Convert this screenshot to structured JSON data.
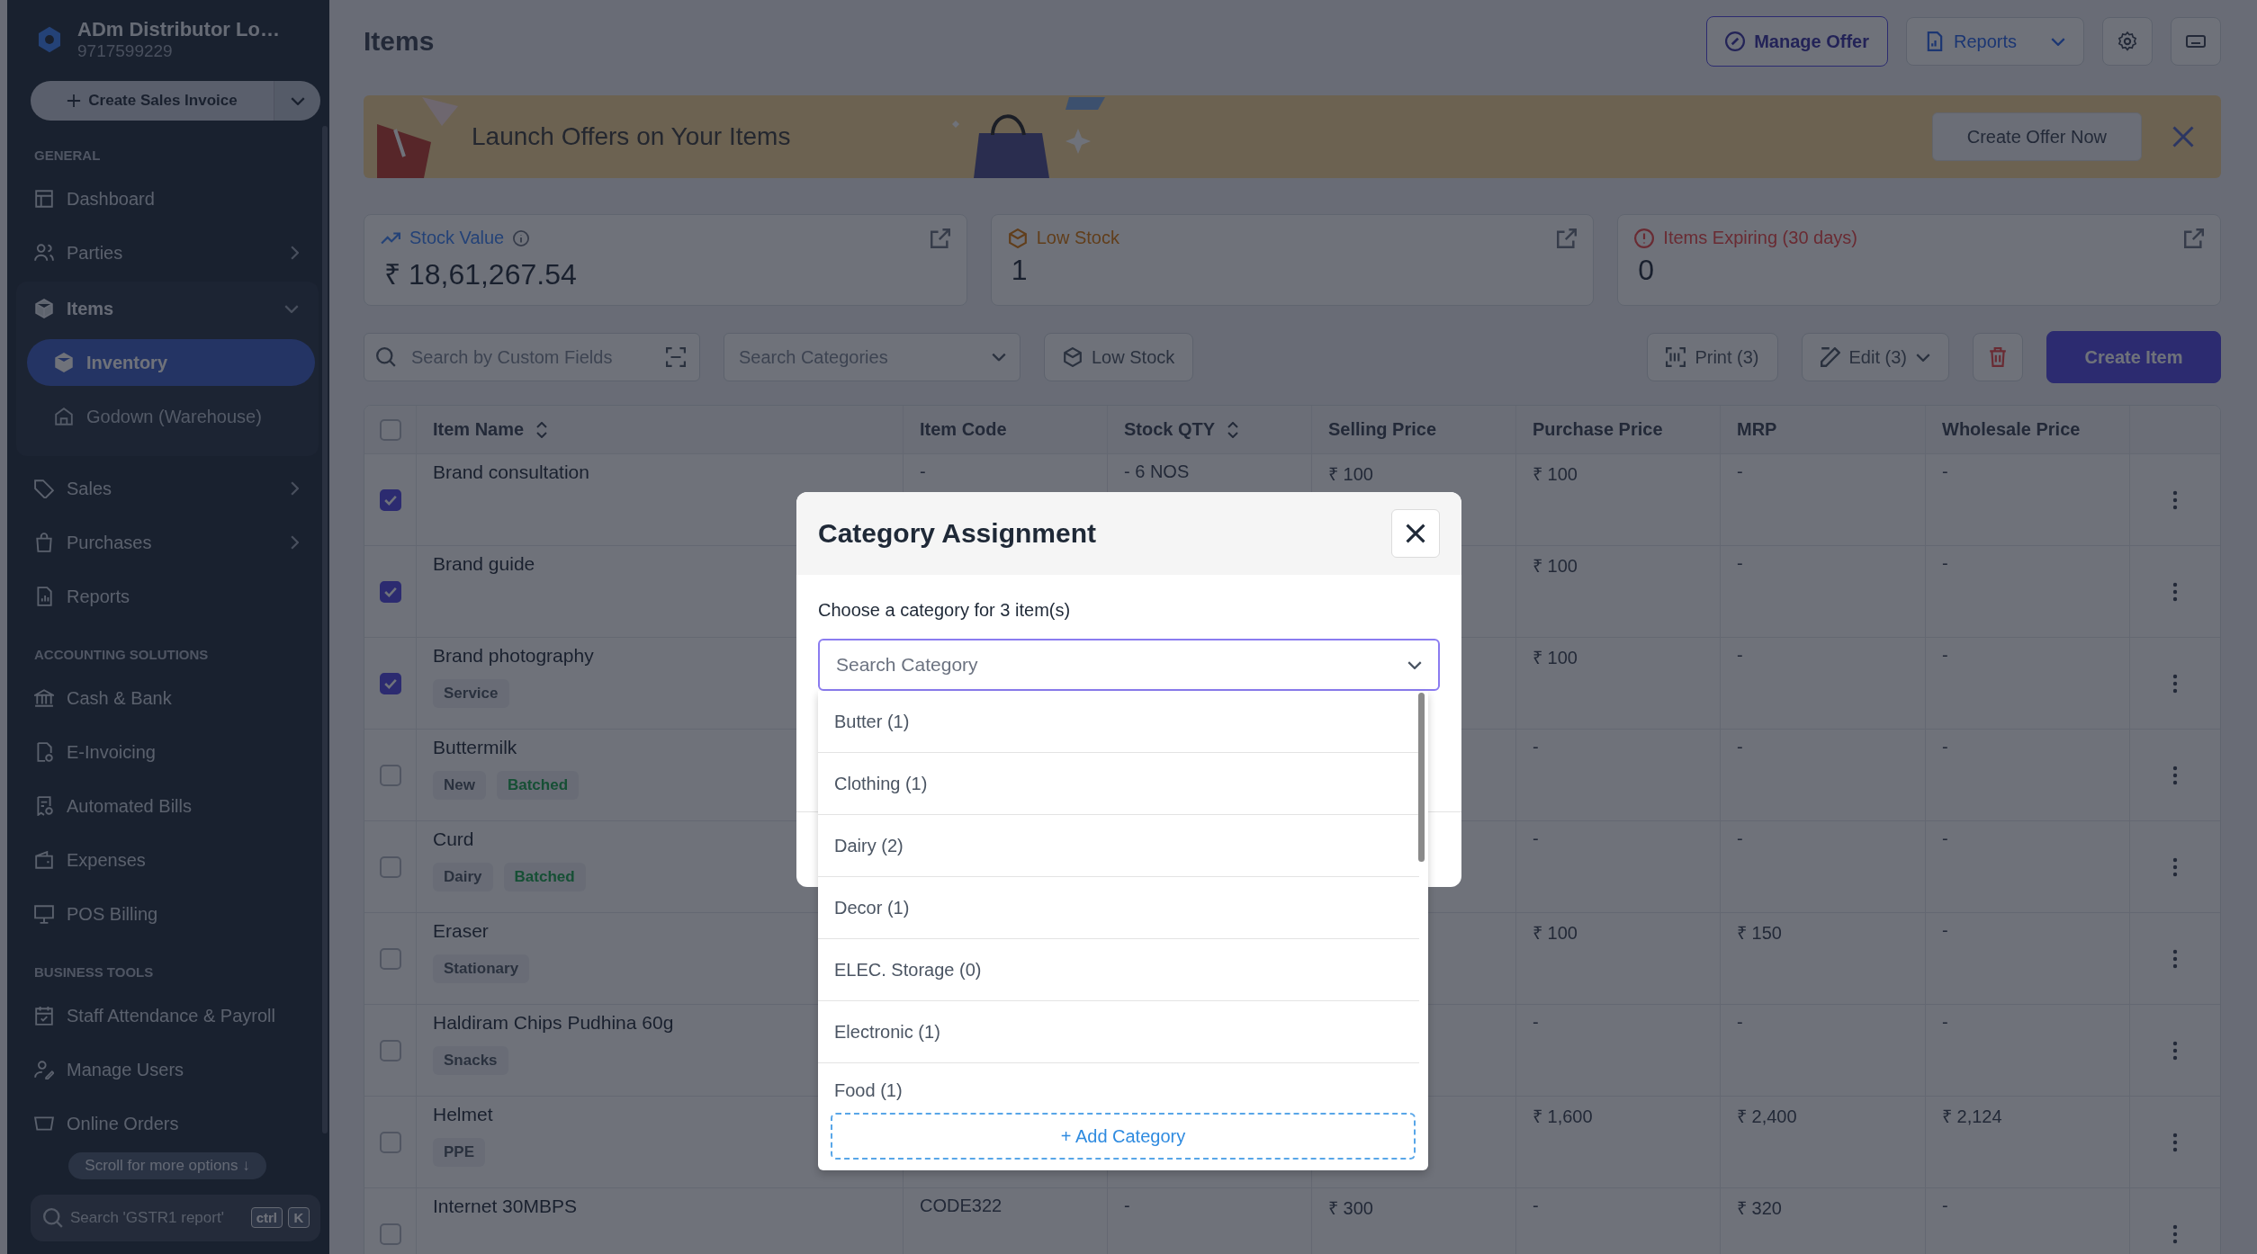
{
  "sidebar": {
    "company": {
      "name": "ADm Distributor Lo…",
      "phone": "9717599229"
    },
    "create_button": "Create Sales Invoice",
    "sections": [
      {
        "title": "GENERAL",
        "items": [
          {
            "label": "Dashboard"
          },
          {
            "label": "Parties",
            "expanded": false
          },
          {
            "label": "Items",
            "expanded": true,
            "children": [
              {
                "label": "Inventory",
                "selected": true
              },
              {
                "label": "Godown (Warehouse)",
                "selected": false
              }
            ]
          },
          {
            "label": "Sales",
            "expanded": false
          },
          {
            "label": "Purchases",
            "expanded": false
          },
          {
            "label": "Reports"
          }
        ]
      },
      {
        "title": "ACCOUNTING SOLUTIONS",
        "items": [
          {
            "label": "Cash & Bank"
          },
          {
            "label": "E-Invoicing"
          },
          {
            "label": "Automated Bills"
          },
          {
            "label": "Expenses"
          },
          {
            "label": "POS Billing"
          }
        ]
      },
      {
        "title": "BUSINESS TOOLS",
        "items": [
          {
            "label": "Staff Attendance & Payroll"
          },
          {
            "label": "Manage Users"
          },
          {
            "label": "Online Orders"
          }
        ]
      }
    ],
    "scroll_hint": "Scroll for more options",
    "scroll_arrow": "↓",
    "search": {
      "placeholder": "Search 'GSTR1 report'",
      "keys": [
        "ctrl",
        "K"
      ]
    }
  },
  "header": {
    "title": "Items",
    "manage_offer": "Manage Offer",
    "reports": "Reports"
  },
  "banner": {
    "text": "Launch Offers on Your Items",
    "button": "Create Offer Now"
  },
  "stats": [
    {
      "kind": "value",
      "label": "Stock Value",
      "value": "₹ 18,61,267.54",
      "info": true
    },
    {
      "kind": "low",
      "label": "Low Stock",
      "value": "1",
      "info": false
    },
    {
      "kind": "expiring",
      "label": "Items Expiring (30 days)",
      "value": "0",
      "info": false
    }
  ],
  "toolbar": {
    "search_placeholder": "Search by Custom Fields",
    "category_placeholder": "Search Categories",
    "low_stock": "Low Stock",
    "print": "Print (3)",
    "edit": "Edit (3)",
    "create": "Create Item"
  },
  "table": {
    "all_checked": false,
    "columns": [
      {
        "label": "Item Name",
        "sortable": true
      },
      {
        "label": "Item Code",
        "sortable": false
      },
      {
        "label": "Stock QTY",
        "sortable": true
      },
      {
        "label": "Selling Price",
        "sortable": false
      },
      {
        "label": "Purchase Price",
        "sortable": false
      },
      {
        "label": "MRP",
        "sortable": false
      },
      {
        "label": "Wholesale Price",
        "sortable": false
      }
    ],
    "rows": [
      {
        "checked": true,
        "tags": [],
        "cells": [
          "Brand consultation",
          "-",
          "- 6 NOS",
          "₹ 100",
          "₹ 100",
          "-",
          "-"
        ]
      },
      {
        "checked": true,
        "tags": [],
        "cells": [
          "Brand guide",
          null,
          null,
          null,
          "₹ 100",
          "-",
          "-"
        ]
      },
      {
        "checked": true,
        "tags": [
          {
            "label": "Service",
            "kind": "plain"
          }
        ],
        "cells": [
          "Brand photography",
          null,
          null,
          null,
          "₹ 100",
          "-",
          "-"
        ]
      },
      {
        "checked": false,
        "tags": [
          {
            "label": "New",
            "kind": "plain"
          },
          {
            "label": "Batched",
            "kind": "batched"
          }
        ],
        "cells": [
          "Buttermilk",
          null,
          null,
          null,
          "-",
          "-",
          "-"
        ]
      },
      {
        "checked": false,
        "tags": [
          {
            "label": "Dairy",
            "kind": "plain"
          },
          {
            "label": "Batched",
            "kind": "batched"
          }
        ],
        "cells": [
          "Curd",
          null,
          null,
          null,
          "-",
          "-",
          "-"
        ]
      },
      {
        "checked": false,
        "tags": [
          {
            "label": "Stationary",
            "kind": "plain"
          }
        ],
        "cells": [
          "Eraser",
          null,
          null,
          null,
          "₹ 100",
          "₹ 150",
          "-"
        ]
      },
      {
        "checked": false,
        "tags": [
          {
            "label": "Snacks",
            "kind": "plain"
          }
        ],
        "cells": [
          "Haldiram Chips Pudhina 60g",
          null,
          null,
          null,
          "-",
          "-",
          "-"
        ]
      },
      {
        "checked": false,
        "tags": [
          {
            "label": "PPE",
            "kind": "plain"
          }
        ],
        "cells": [
          "Helmet",
          null,
          null,
          null,
          "₹ 1,600",
          "₹ 2,400",
          "₹ 2,124"
        ]
      },
      {
        "checked": false,
        "tags": [],
        "cells": [
          "Internet 30MBPS",
          "CODE322",
          "-",
          "₹ 300",
          "-",
          "₹ 320",
          "-"
        ]
      }
    ]
  },
  "modal": {
    "title": "Category Assignment",
    "prompt": "Choose a category for 3 item(s)",
    "search_placeholder": "Search Category",
    "options": [
      "Butter (1)",
      "Clothing (1)",
      "Dairy (2)",
      "Decor (1)",
      "ELEC. Storage (0)",
      "Electronic (1)",
      "Food (1)"
    ],
    "add_button": "+ Add Category"
  }
}
